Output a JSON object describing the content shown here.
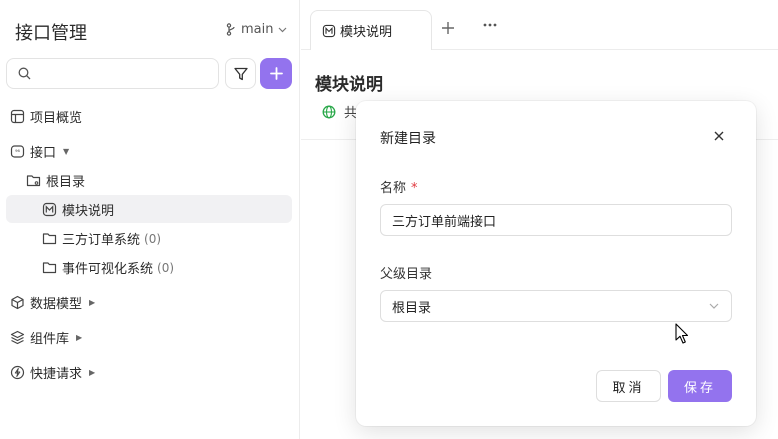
{
  "sidebar": {
    "title": "接口管理",
    "branch": "main",
    "search": {
      "placeholder": "",
      "value": ""
    },
    "items": [
      {
        "label": "项目概览",
        "icon": "project-overview-icon"
      },
      {
        "label": "接口",
        "icon": "api-icon"
      },
      {
        "label": "根目录",
        "icon": "root-folder-icon"
      },
      {
        "label": "模块说明",
        "icon": "markdown-icon"
      },
      {
        "label": "三方订单系统",
        "count": "(0)",
        "icon": "folder-icon"
      },
      {
        "label": "事件可视化系统",
        "count": "(0)",
        "icon": "folder-icon"
      },
      {
        "label": "数据模型",
        "icon": "data-model-icon"
      },
      {
        "label": "组件库",
        "icon": "components-icon"
      },
      {
        "label": "快捷请求",
        "icon": "quick-request-icon"
      }
    ]
  },
  "tabs": [
    {
      "label": "模块说明",
      "icon": "markdown-icon"
    }
  ],
  "main": {
    "title": "模块说明",
    "share_label": "共"
  },
  "modal": {
    "title": "新建目录",
    "name_label": "名称",
    "required_mark": "*",
    "name_value": "三方订单前端接口",
    "parent_label": "父级目录",
    "parent_value": "根目录",
    "cancel_label": "取消",
    "save_label": "保存"
  },
  "colors": {
    "accent": "#9373ee",
    "required": "#e0383e",
    "selected_bg": "#f1f1f3",
    "share_icon": "#2aa84a"
  }
}
